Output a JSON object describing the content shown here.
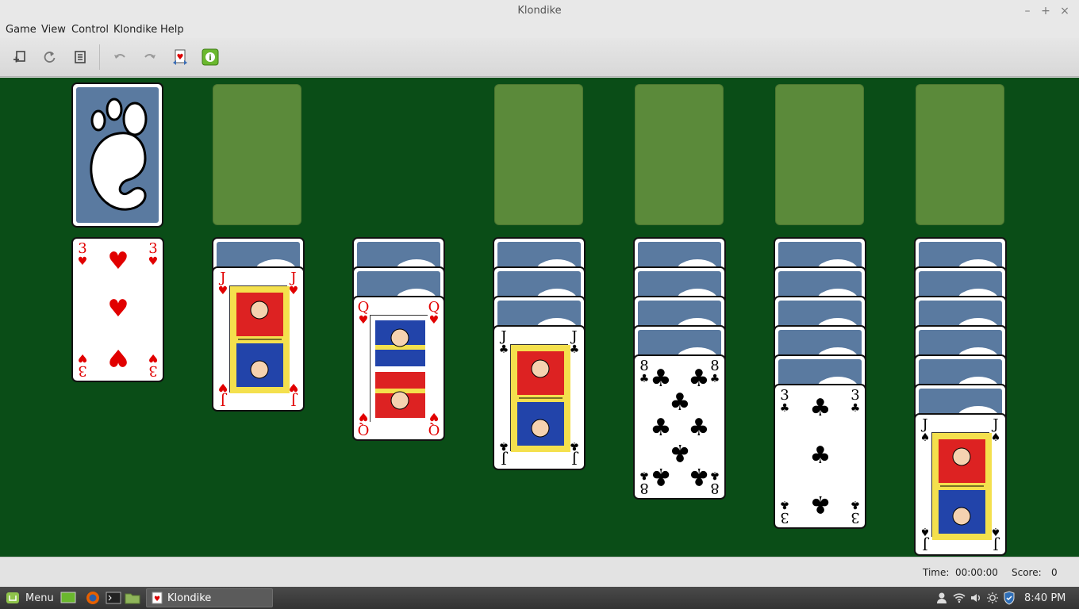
{
  "window": {
    "title": "Klondike",
    "minimize": "–",
    "maximize": "+",
    "close": "×"
  },
  "menubar": {
    "items": [
      "Game",
      "View",
      "Control",
      "Klondike",
      "Help"
    ]
  },
  "toolbar": {
    "buttons": [
      "new-game-icon",
      "restart-icon",
      "select-game-icon",
      "undo-icon",
      "redo-icon",
      "hint-icon",
      "deal-info-icon"
    ]
  },
  "game": {
    "stock": {
      "face": "back"
    },
    "foundations": 4,
    "tableau": [
      {
        "hidden": 0,
        "top": {
          "rank": "3",
          "suit": "♥",
          "color": "red"
        }
      },
      {
        "hidden": 1,
        "top": {
          "rank": "J",
          "suit": "♥",
          "color": "red"
        }
      },
      {
        "hidden": 2,
        "top": {
          "rank": "Q",
          "suit": "♥",
          "color": "red"
        }
      },
      {
        "hidden": 3,
        "top": {
          "rank": "J",
          "suit": "♣",
          "color": "black"
        }
      },
      {
        "hidden": 4,
        "top": {
          "rank": "8",
          "suit": "♣",
          "color": "black"
        }
      },
      {
        "hidden": 5,
        "top": {
          "rank": "3",
          "suit": "♣",
          "color": "black"
        }
      },
      {
        "hidden": 6,
        "top": {
          "rank": "J",
          "suit": "♠",
          "color": "black"
        }
      }
    ],
    "colors": {
      "felt": "#0a4d17",
      "slot": "#5b8a3a",
      "card_back": "#5a7aa0",
      "red": "#e10000"
    }
  },
  "status": {
    "time_label": "Time:",
    "time_value": "00:00:00",
    "score_label": "Score:",
    "score_value": "0"
  },
  "taskbar": {
    "menu_label": "Menu",
    "window_label": "Klondike",
    "clock": "8:40 PM"
  }
}
